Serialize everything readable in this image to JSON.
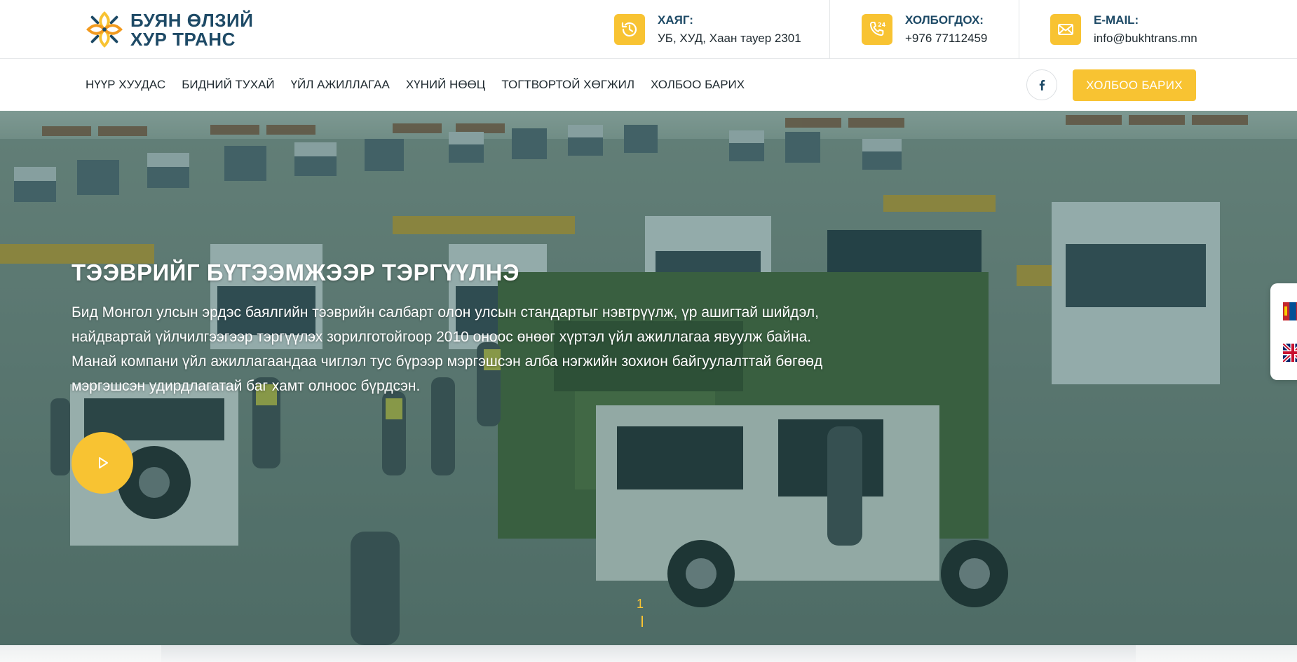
{
  "brand": {
    "line1": "БУЯН ӨЛЗИЙ",
    "line2": "ХУР ТРАНС",
    "logo_icon": "ornament-logo-icon",
    "colors": {
      "navy": "#1e4a66",
      "gold": "#f8c332",
      "orange": "#f29a1e"
    }
  },
  "contacts": [
    {
      "label": "ХАЯГ:",
      "value": "УБ, ХУД, Хаан тауер 2301",
      "icon": "clock-icon"
    },
    {
      "label": "ХОЛБОГДОХ:",
      "value": "+976 77112459",
      "icon": "phone-24-icon"
    },
    {
      "label": "E-MAIL:",
      "value": "info@bukhtrans.mn",
      "icon": "envelope-icon"
    }
  ],
  "nav": {
    "items": [
      "НҮҮР ХУУДАС",
      "БИДНИЙ ТУХАЙ",
      "ҮЙЛ АЖИЛЛАГАА",
      "ХҮНИЙ НӨӨЦ",
      "ТОГТВОРТОЙ ХӨГЖИЛ",
      "ХОЛБОО БАРИХ"
    ],
    "social_icon": "facebook-icon",
    "cta_label": "ХОЛБОО БАРИХ"
  },
  "hero": {
    "title": "ТЭЭВРИЙГ БҮТЭЭМЖЭЭР ТЭРГҮҮЛНЭ",
    "description": "Бид Монгол улсын эрдэс баялгийн тээврийн салбарт олон улсын стандартыг нэвтрүүлж, үр ашигтай шийдэл, найдвартай үйлчилгээгээр тэргүүлэх зорилготойгоор 2010 оноос өнөөг хүртэл үйл ажиллагаа явуулж байна. Манай компани үйл ажиллагаандаа чиглэл тус бүрээр мэргэшсэн алба нэгжийн зохион байгуулалттай бөгөөд мэргэшсэн удирдлагатай баг хамт олноос бүрдсэн.",
    "play_icon": "play-icon",
    "slide_number": "1",
    "overlay_color": "#124a46"
  },
  "languages": [
    {
      "code": "mn",
      "icon": "mongolia-flag-icon"
    },
    {
      "code": "en",
      "icon": "uk-flag-icon"
    }
  ]
}
